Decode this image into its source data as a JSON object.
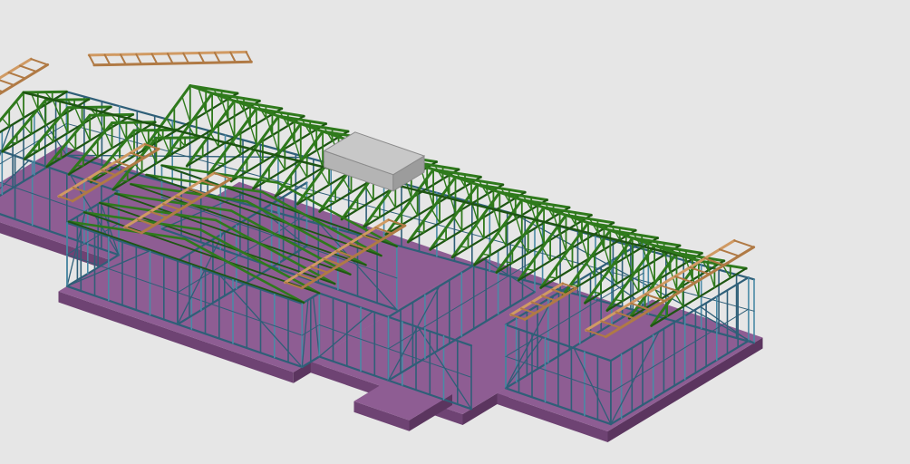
{
  "scene": {
    "background_color": "#e6e6e6",
    "colors": {
      "slab_top": "#8e5d93",
      "slab_side": "#6e4373",
      "slab_shadow": "#5b355f",
      "wall_frame": "#2f5f78",
      "wall_frame_light": "#4a8aa6",
      "truss": "#2f7a1c",
      "truss_dark": "#1e5512",
      "timber": "#b07a45",
      "timber_light": "#d09a63",
      "equipment": "#c8c8c8"
    },
    "components": [
      "concrete-slab",
      "wall-frames",
      "roof-trusses",
      "timber-battens",
      "roof-equipment-box"
    ]
  }
}
